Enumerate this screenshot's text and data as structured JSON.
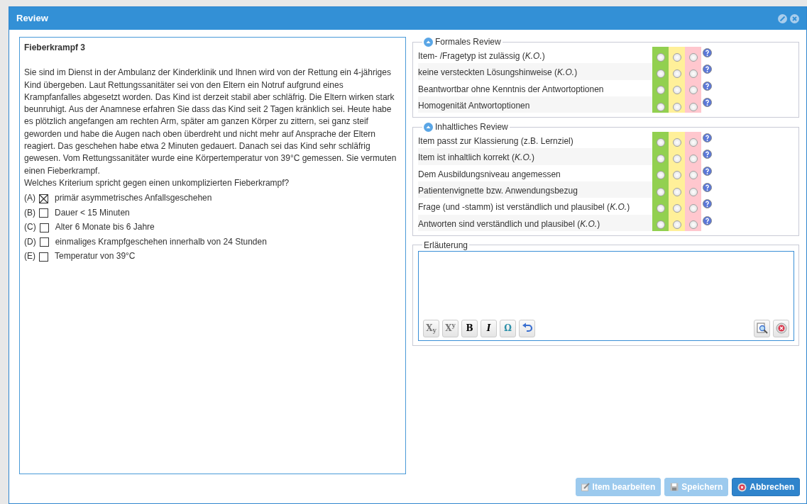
{
  "window": {
    "title": "Review"
  },
  "question": {
    "title": "Fieberkrampf 3",
    "stem": "Sie sind im Dienst in der Ambulanz der Kinderklinik und Ihnen wird von der Rettung ein 4-jähriges Kind übergeben. Laut Rettungssanitäter sei von den Eltern ein Notruf aufgrund eines Krampfanfalles abgesetzt worden. Das Kind ist derzeit stabil aber schläfrig. Die Eltern wirken stark beunruhigt. Aus der Anamnese erfahren Sie dass das Kind seit 2 Tagen kränklich sei. Heute habe es plötzlich angefangen am rechten Arm, später am ganzen Körper zu zittern, sei ganz steif geworden und habe die Augen nach oben überdreht und nicht mehr auf Ansprache der Eltern reagiert. Das geschehen habe etwa 2 Minuten gedauert. Danach sei das Kind sehr schläfrig gewesen. Vom Rettungssanitäter wurde eine Körpertemperatur von 39°C gemessen. Sie vermuten einen Fieberkrampf.",
    "prompt": "Welches Kriterium spricht gegen einen unkomplizierten Fieberkrampf?",
    "answers": [
      {
        "letter": "(A)",
        "text": "primär asymmetrisches Anfallsgeschehen",
        "checked": true
      },
      {
        "letter": "(B)",
        "text": "Dauer < 15 Minuten",
        "checked": false
      },
      {
        "letter": "(C)",
        "text": "Alter 6 Monate bis 6 Jahre",
        "checked": false
      },
      {
        "letter": "(D)",
        "text": "einmaliges Krampfgeschehen innerhalb von 24 Stunden",
        "checked": false
      },
      {
        "letter": "(E)",
        "text": "Temperatur von 39°C",
        "checked": false
      }
    ]
  },
  "sections": [
    {
      "title": "Formales Review",
      "expanded": true,
      "criteria": [
        {
          "label": "Item- /Fragetyp ist zulässig (*K.O.*)",
          "ratings": [
            {
              "selected": false
            },
            {
              "selected": false
            },
            {
              "selected": false
            }
          ]
        },
        {
          "label": "keine versteckten Lösungshinweise (*K.O.*)",
          "ratings": [
            {
              "selected": false
            },
            {
              "selected": false
            },
            {
              "selected": false
            }
          ]
        },
        {
          "label": "Beantwortbar ohne Kenntnis der Antwortoptionen",
          "ratings": [
            {
              "selected": false
            },
            {
              "selected": false
            },
            {
              "selected": false
            }
          ]
        },
        {
          "label": "Homogenität Antwortoptionen",
          "ratings": [
            {
              "selected": false
            },
            {
              "selected": false
            },
            {
              "selected": false
            }
          ]
        }
      ]
    },
    {
      "title": "Inhaltliches Review",
      "expanded": true,
      "criteria": [
        {
          "label": "Item passt zur Klassierung (z.B. Lernziel)",
          "ratings": [
            {
              "selected": false
            },
            {
              "selected": false
            },
            {
              "selected": false
            }
          ]
        },
        {
          "label": "Item ist inhaltlich korrekt (*K.O.*)",
          "ratings": [
            {
              "selected": false
            },
            {
              "selected": false
            },
            {
              "selected": false
            }
          ]
        },
        {
          "label": "Dem Ausbildungsniveau angemessen",
          "ratings": [
            {
              "selected": false
            },
            {
              "selected": false
            },
            {
              "selected": false
            }
          ]
        },
        {
          "label": "Patientenvignette bzw. Anwendungsbezug",
          "ratings": [
            {
              "selected": false
            },
            {
              "selected": false
            },
            {
              "selected": false
            }
          ]
        },
        {
          "label": "Frage (und -stamm) ist verständlich und plausibel (*K.O.*)",
          "ratings": [
            {
              "selected": false
            },
            {
              "selected": false
            },
            {
              "selected": false
            }
          ]
        },
        {
          "label": "Antworten sind verständlich und plausibel (*K.O.*)",
          "ratings": [
            {
              "selected": false
            },
            {
              "selected": false
            },
            {
              "selected": false
            }
          ]
        }
      ]
    }
  ],
  "explanation": {
    "title": "Erläuterung",
    "toolbar": [
      {
        "kind": "subscript",
        "label": "X$_{y}$"
      },
      {
        "kind": "superscript",
        "label": "X$^{y}$"
      },
      {
        "kind": "bold",
        "label": "B"
      },
      {
        "kind": "italic",
        "label": "I"
      },
      {
        "kind": "symbol",
        "label": "Ω"
      },
      {
        "kind": "undo"
      }
    ],
    "toolbar_right": [
      {
        "kind": "preview"
      },
      {
        "kind": "clear"
      }
    ]
  },
  "buttons": [
    {
      "kind": "edit",
      "label": "Item bearbeiten",
      "disabled": true
    },
    {
      "kind": "save",
      "label": "Speichern",
      "disabled": true
    },
    {
      "kind": "cancel",
      "label": "Abbrechen",
      "disabled": false
    }
  ]
}
